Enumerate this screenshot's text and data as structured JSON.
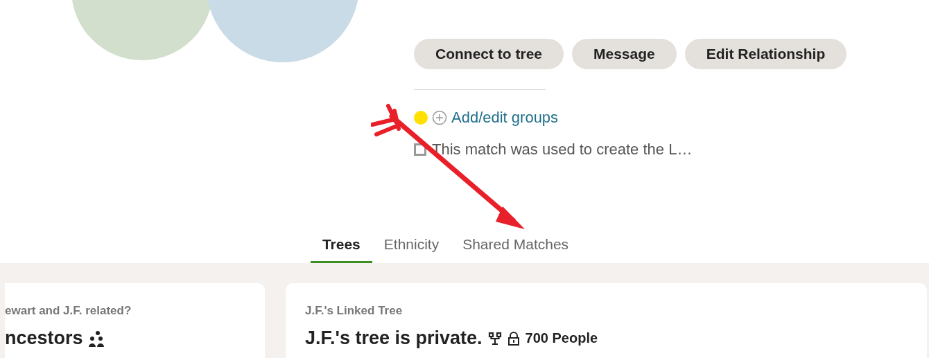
{
  "actions": [
    {
      "label": "Connect to tree"
    },
    {
      "label": "Message"
    },
    {
      "label": "Edit Relationship"
    }
  ],
  "groups_link": "Add/edit groups",
  "note": {
    "text": "This match was used to create the L…",
    "checked": false
  },
  "tabs": [
    {
      "label": "Trees",
      "selected": true
    },
    {
      "label": "Ethnicity",
      "selected": false
    },
    {
      "label": "Shared Matches",
      "selected": false
    }
  ],
  "relationship_card": {
    "question": "ewart and J.F. related?",
    "heading": "ncestors"
  },
  "tree_card": {
    "title": "J.F.'s Linked Tree",
    "heading": "J.F.'s tree is private.",
    "count": "700 People"
  }
}
